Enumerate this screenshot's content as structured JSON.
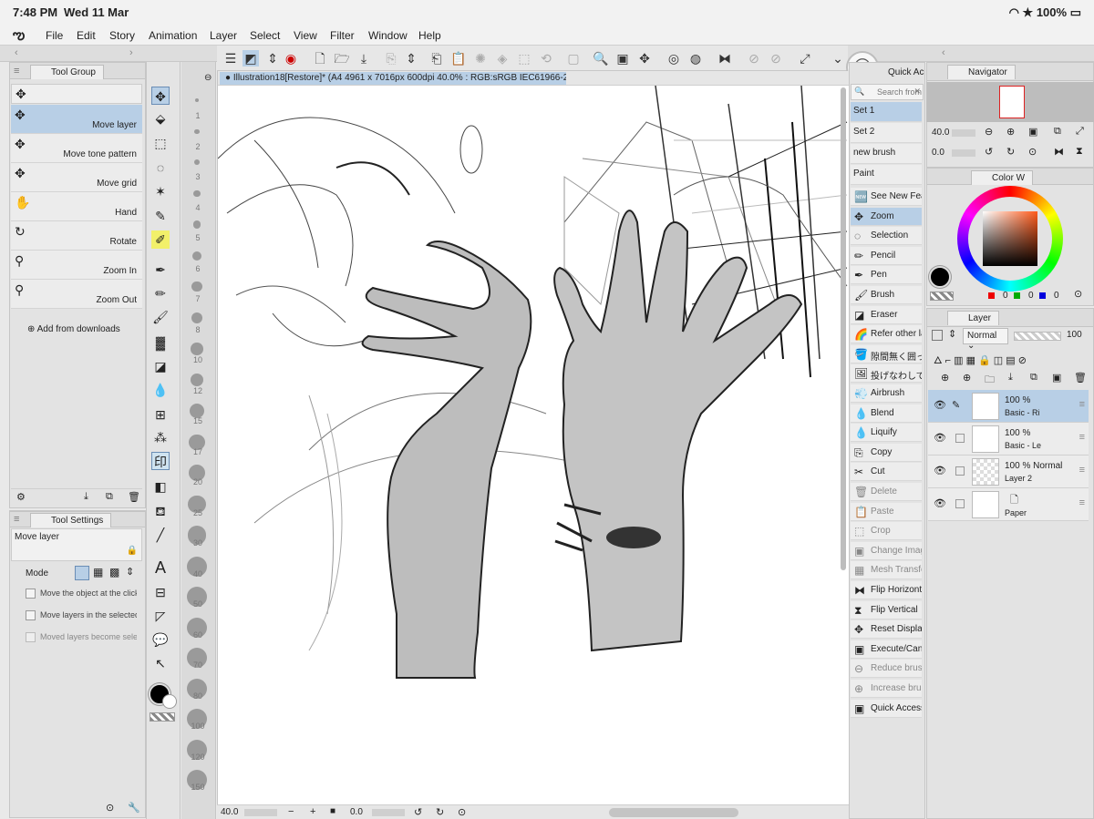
{
  "status": {
    "time": "7:48 PM",
    "date": "Wed 11 Mar",
    "battery": "100%"
  },
  "menu": [
    "File",
    "Edit",
    "Story",
    "Animation",
    "Layer",
    "Select",
    "View",
    "Filter",
    "Window",
    "Help"
  ],
  "canvas": {
    "title": "Illustration18[Restore]* (A4 4961 x 7016px 600dpi 40.0% : RGB:sRGB IEC61966-2.1)",
    "zoom": "40.0",
    "rotate": "0.0"
  },
  "toolgroup": {
    "tab": "Tool Group",
    "items": [
      "Move layer",
      "Move tone pattern",
      "Move grid",
      "Hand",
      "Rotate",
      "Zoom In",
      "Zoom Out"
    ],
    "add": "Add from downloads"
  },
  "toolsettings": {
    "tab": "Tool Settings",
    "name": "Move layer",
    "mode_label": "Mode",
    "options": [
      "Move the object at the clicked pos",
      "Move layers in the selected area",
      "Moved layers become selected"
    ]
  },
  "ruler": [
    "1",
    "2",
    "3",
    "4",
    "5",
    "6",
    "7",
    "8",
    "10",
    "12",
    "15",
    "17",
    "20",
    "25",
    "30",
    "40",
    "50",
    "60",
    "70",
    "80",
    "100",
    "120",
    "150"
  ],
  "quickaccess": {
    "tab": "Quick Ac",
    "search": "Search from",
    "sets": [
      "Set 1",
      "Set 2",
      "new brush",
      "Paint"
    ],
    "items": [
      "See New Featur",
      "Zoom",
      "Selection",
      "Pencil",
      "Pen",
      "Brush",
      "Eraser",
      "Refer other laye",
      "隙間無く囲って",
      "投げなわして塗る",
      "Airbrush",
      "Blend",
      "Liquify",
      "Copy",
      "Cut",
      "Delete",
      "Paste",
      "Crop",
      "Change Image F",
      "Mesh Transform",
      "Flip Horizontal",
      "Flip Vertical",
      "Reset Display",
      "Execute/Cancel",
      "Reduce brush s",
      "Increase brush",
      "Quick Access S"
    ]
  },
  "navigator": {
    "tab": "Navigator",
    "zoom": "40.0",
    "rotate": "0.0"
  },
  "color": {
    "tab": "Color W",
    "r": "0",
    "g": "0",
    "b": "0",
    "accent": "#b8cfe6"
  },
  "layer": {
    "tab": "Layer",
    "blend": "Normal",
    "opacity": "100",
    "layers": [
      {
        "pct": "100 %",
        "mode": "Basic - Ri",
        "name": ""
      },
      {
        "pct": "100 %",
        "mode": "Basic - Le",
        "name": ""
      },
      {
        "pct": "100 % Normal",
        "mode": "",
        "name": "Layer 2"
      },
      {
        "pct": "",
        "mode": "",
        "name": "Paper"
      }
    ]
  }
}
